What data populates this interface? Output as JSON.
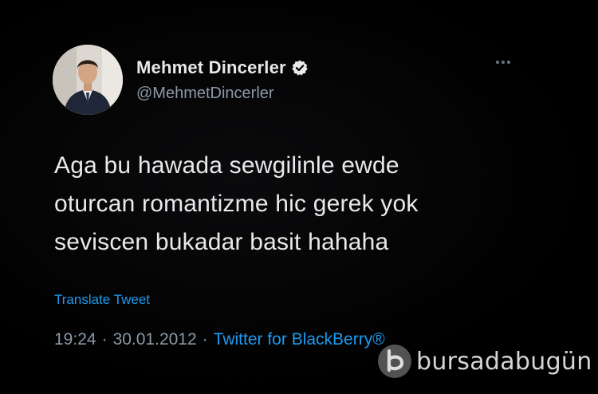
{
  "tweet": {
    "author": {
      "display_name": "Mehmet Dincerler",
      "handle": "@MehmetDincerler",
      "verified": true
    },
    "more_icon": "more-horizontal-icon",
    "text": "Aga bu hawada sewgilinle ewde\noturcan romantizme hic gerek yok\nseviscen bukadar basit hahaha",
    "translate_label": "Translate Tweet",
    "time": "19:24",
    "separator": "·",
    "date": "30.01.2012",
    "source": "Twitter for BlackBerry®"
  },
  "watermark": {
    "text": "bursadabugün"
  },
  "colors": {
    "background": "#000000",
    "primary_text": "#e7e9ea",
    "secondary_text": "#8b98a5",
    "link_blue": "#1d9bf0"
  }
}
